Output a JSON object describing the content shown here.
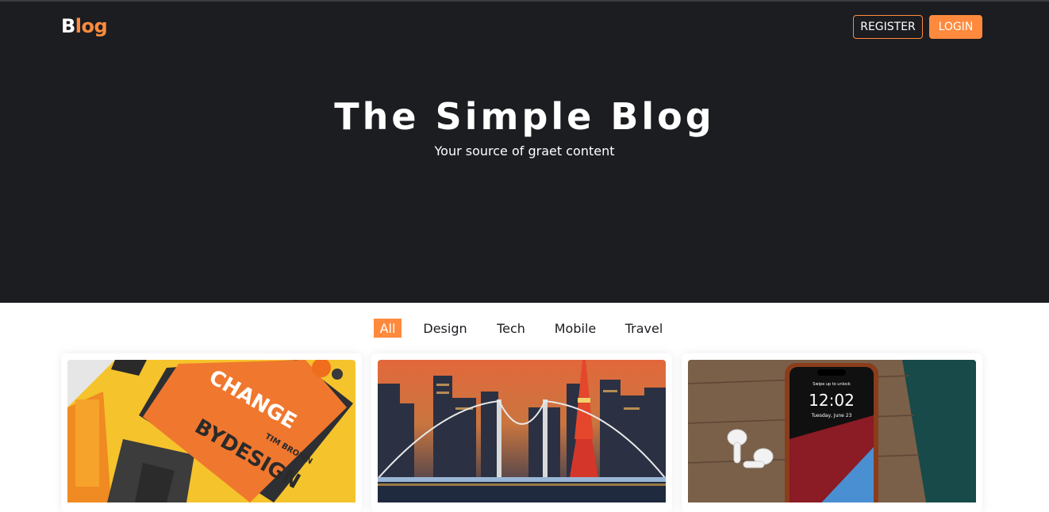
{
  "header": {
    "logo_first": "B",
    "logo_rest": "log",
    "register_label": "REGISTER",
    "login_label": "LOGIN"
  },
  "hero": {
    "title": "The Simple Blog",
    "subtitle": "Your source of graet content"
  },
  "filters": [
    {
      "label": "All",
      "active": true
    },
    {
      "label": "Design",
      "active": false
    },
    {
      "label": "Tech",
      "active": false
    },
    {
      "label": "Mobile",
      "active": false
    },
    {
      "label": "Travel",
      "active": false
    }
  ],
  "cards": [
    {
      "image": "design-book-image",
      "book_lines": [
        "CHANGE",
        "BY",
        "DESIGN",
        "TIM BROWN"
      ]
    },
    {
      "image": "city-bridge-night-image"
    },
    {
      "image": "phone-earbuds-image",
      "phone_time": "12:02",
      "phone_date": "Tuesday, June 23",
      "phone_unlock": "Swipe up to unlock"
    }
  ],
  "colors": {
    "accent": "#ff8a3d",
    "hero_bg": "#1b1d21"
  }
}
